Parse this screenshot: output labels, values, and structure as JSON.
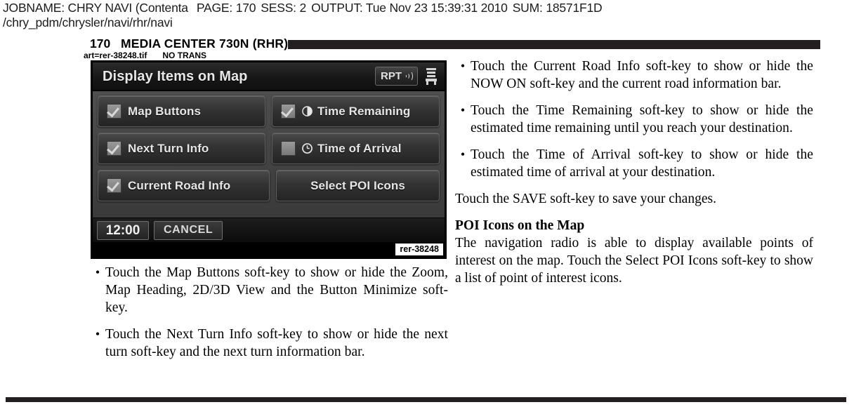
{
  "job_header": {
    "jobname_label": "JOBNAME:",
    "jobname_value": "CHRY NAVI (Contenta",
    "page_label": "PAGE:",
    "page_value": "170",
    "sess_label": "SESS:",
    "sess_value": "2",
    "output_label": "OUTPUT:",
    "output_value": "Tue Nov 23 15:39:31 2010",
    "sum_label": "SUM:",
    "sum_value": "18571F1D",
    "path": "/chry_pdm/chrysler/navi/rhr/navi"
  },
  "page_title_row": {
    "page_number": "170",
    "title": "MEDIA CENTER 730N (RHR)"
  },
  "art_slug": {
    "art": "art=rer-38248.tif",
    "trans": "NO TRANS"
  },
  "figure": {
    "tag": "rer-38248",
    "screen": {
      "header_title": "Display Items on Map",
      "rpt_label": "RPT",
      "rows": [
        [
          {
            "label": "Map Buttons",
            "checkbox": "checked",
            "icon": null
          },
          {
            "label": "Time Remaining",
            "checkbox": "checked",
            "icon": "pie-chart-icon"
          }
        ],
        [
          {
            "label": "Next Turn Info",
            "checkbox": "checked",
            "icon": null
          },
          {
            "label": "Time of Arrival",
            "checkbox": "unchecked",
            "icon": "clock-icon"
          }
        ],
        [
          {
            "label": "Current Road Info",
            "checkbox": "checked",
            "icon": null
          },
          {
            "label": "Select POI Icons",
            "checkbox": null,
            "icon": null
          }
        ]
      ],
      "clock": "12:00",
      "cancel_label": "CANCEL"
    },
    "colors": {
      "screen_background": "#000000",
      "header_text": "#e8e8e8",
      "softkey_text": "#e6e6e6",
      "rule": "#231f20"
    }
  },
  "left_column": {
    "bullets": [
      "Touch the Map Buttons soft-key to show or hide the Zoom, Map Heading, 2D/3D View and the Button Minimize soft-key.",
      "Touch the Next Turn Info soft-key to show or hide the next turn soft-key and the next turn information bar."
    ]
  },
  "right_column": {
    "bullets": [
      "Touch the Current Road Info soft-key to show or hide the NOW ON soft-key and the current road information bar.",
      "Touch the Time Remaining soft-key to show or hide the estimated time remaining until you reach your destination.",
      "Touch the Time of Arrival soft-key to show or hide the estimated time of arrival at your destination."
    ],
    "save_paragraph": "Touch the SAVE soft-key to save your changes.",
    "poi_heading": "POI Icons on the Map",
    "poi_paragraph": "The navigation radio is able to display available points of interest on the map. Touch the Select POI Icons soft-key to show a list of point of interest icons."
  },
  "bullet_glyph": "•"
}
